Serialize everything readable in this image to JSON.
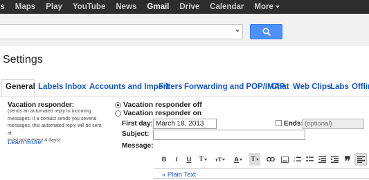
{
  "topnav": {
    "items": [
      {
        "label": "es",
        "active": false
      },
      {
        "label": "Maps",
        "active": false
      },
      {
        "label": "Play",
        "active": false
      },
      {
        "label": "YouTube",
        "active": false
      },
      {
        "label": "News",
        "active": false
      },
      {
        "label": "Gmail",
        "active": true
      },
      {
        "label": "Drive",
        "active": false
      },
      {
        "label": "Calendar",
        "active": false
      },
      {
        "label": "More",
        "active": false
      }
    ]
  },
  "search": {
    "value": "",
    "button_icon": "search-icon"
  },
  "page": {
    "title": "Settings"
  },
  "tabs": [
    "General",
    "Labels",
    "Inbox",
    "Accounts and Import",
    "Filters",
    "Forwarding and POP/IMAP",
    "Chat",
    "Web Clips",
    "Labs",
    "Offline"
  ],
  "vacation": {
    "label": "Vacation responder:",
    "desc_lines": [
      "(sends an automated reply to incoming",
      "messages. If a contact sends you several",
      "messages, this automated reply will be sent at",
      "most once every 4 days)"
    ],
    "learn_more": "Learn more",
    "off_label": "Vacation responder off",
    "on_label": "Vacation responder on",
    "selected": "off",
    "first_day_label": "First day:",
    "first_day_value": "March 18, 2013",
    "ends_label": "Ends:",
    "ends_placeholder": "(optional)",
    "subject_label": "Subject:",
    "subject_value": "",
    "message_label": "Message:"
  },
  "editor": {
    "toolbar": [
      "B",
      "I",
      "U",
      "T",
      "тT",
      "A",
      "T",
      "link",
      "image",
      "ol",
      "ul",
      "outdent",
      "indent",
      "quote",
      "align"
    ],
    "plain_text_link": "« Plain Text"
  }
}
